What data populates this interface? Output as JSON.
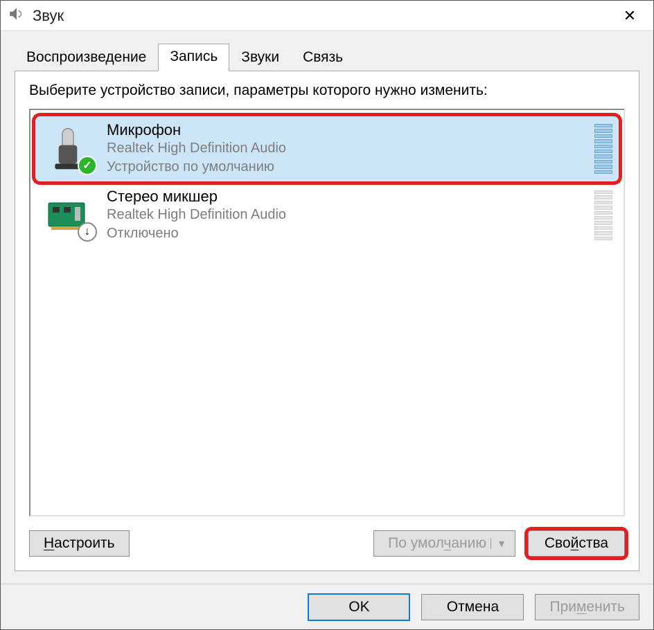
{
  "window": {
    "title": "Звук"
  },
  "tabs": {
    "items": [
      {
        "label": "Воспроизведение"
      },
      {
        "label": "Запись"
      },
      {
        "label": "Звуки"
      },
      {
        "label": "Связь"
      }
    ],
    "active_index": 1
  },
  "panel": {
    "prompt": "Выберите устройство записи, параметры которого нужно изменить:",
    "devices": [
      {
        "name": "Микрофон",
        "driver": "Realtek High Definition Audio",
        "status": "Устройство по умолчанию",
        "status_kind": "default",
        "selected": true,
        "highlighted": true,
        "icon": "microphone"
      },
      {
        "name": "Стерео микшер",
        "driver": "Realtek High Definition Audio",
        "status": "Отключено",
        "status_kind": "disabled",
        "selected": false,
        "highlighted": false,
        "icon": "sound-card"
      }
    ],
    "buttons": {
      "configure": "Настроить",
      "set_default": "По умолчанию",
      "properties": "Свойства",
      "set_default_enabled": false,
      "properties_highlighted": true
    },
    "configure_underline": "Н",
    "set_default_underline": "ч",
    "properties_underline": "й"
  },
  "bottom": {
    "ok": "OK",
    "cancel": "Отмена",
    "apply": "Применить",
    "apply_enabled": false,
    "apply_underline": "м"
  }
}
